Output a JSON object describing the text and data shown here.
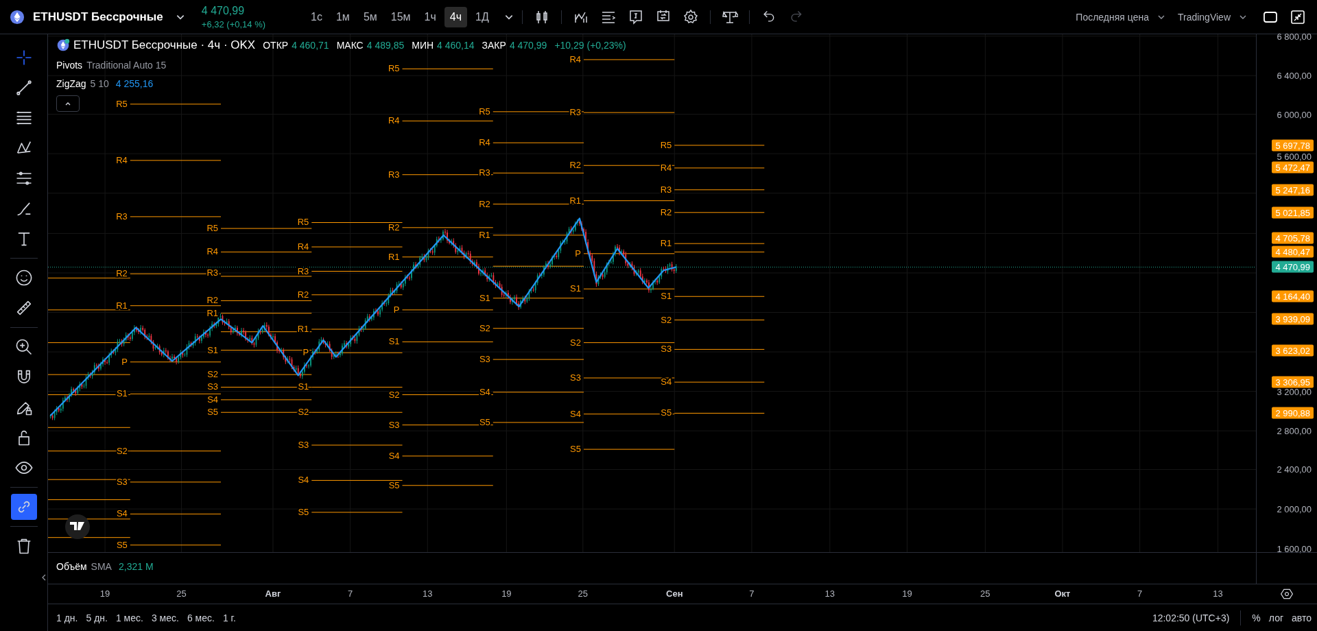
{
  "header": {
    "symbol": "ETHUSDT Бессрочные",
    "price": "4 470,99",
    "change": "+6,32 (+0,14 %)",
    "intervals": [
      {
        "label": "1с",
        "selected": false
      },
      {
        "label": "1м",
        "selected": false
      },
      {
        "label": "5м",
        "selected": false
      },
      {
        "label": "15м",
        "selected": false
      },
      {
        "label": "1ч",
        "selected": false
      },
      {
        "label": "4ч",
        "selected": true
      },
      {
        "label": "1Д",
        "selected": false
      }
    ],
    "history": [
      {
        "kind": "undo",
        "disabled": false
      },
      {
        "kind": "redo",
        "disabled": true
      }
    ],
    "price_source": "Последняя цена",
    "chart_brand": "TradingView"
  },
  "toolbar": [
    {
      "kind": "crosshair",
      "selected": true
    },
    {
      "kind": "trend-line",
      "selected": false
    },
    {
      "kind": "fib",
      "selected": false
    },
    {
      "kind": "pattern",
      "selected": false
    },
    {
      "kind": "parallel",
      "selected": false
    },
    {
      "kind": "brush",
      "selected": false
    },
    {
      "kind": "text",
      "selected": false
    },
    {
      "kind": "emoji",
      "selected": false
    },
    {
      "kind": "ruler",
      "selected": false
    },
    {
      "kind": "zoom",
      "selected": false
    },
    {
      "kind": "magnet",
      "selected": false,
      "on": false
    },
    {
      "kind": "pencil-lock",
      "selected": false,
      "on": false
    },
    {
      "kind": "lock",
      "selected": false,
      "on": false
    },
    {
      "kind": "eye",
      "selected": false,
      "on": false
    },
    {
      "kind": "link",
      "selected": false,
      "on": true
    },
    {
      "kind": "trash",
      "selected": false
    }
  ],
  "legend": {
    "title": "ETHUSDT Бессрочные · 4ч · OKX",
    "ohlc": [
      {
        "label": "ОТКР",
        "value": "4 460,71"
      },
      {
        "label": "МАКС",
        "value": "4 489,85"
      },
      {
        "label": "МИН",
        "value": "4 460,14"
      },
      {
        "label": "ЗАКР",
        "value": "4 470,99"
      }
    ],
    "change": "+10,29 (+0,23%)",
    "indicators": [
      {
        "name": "Pivots",
        "params": "Traditional Auto 15"
      },
      {
        "name": "ZigZag",
        "params": "5 10",
        "value": "4 255,16"
      }
    ]
  },
  "pivots": [
    {
      "levels": [
        "R5",
        "R4",
        "R3",
        "R2",
        "R1",
        "P",
        "S1",
        "S2",
        "S3",
        "S4",
        "S5"
      ]
    },
    {
      "levels": [
        "R5",
        "R4",
        "R3",
        "R2",
        "R1",
        "S1",
        "S2",
        "S3",
        "S4",
        "S5"
      ]
    },
    {
      "levels": [
        "R5",
        "R4",
        "R3",
        "R2",
        "R1",
        "P",
        "S1",
        "S2",
        "S3",
        "S4",
        "S5"
      ]
    },
    {
      "levels": [
        "R5",
        "R4",
        "R3",
        "R2",
        "R1",
        "P",
        "S1",
        "S2",
        "S3",
        "S4",
        "S5"
      ]
    },
    {
      "levels": [
        "R5",
        "R4",
        "R3",
        "R2",
        "R1",
        "S1",
        "S2",
        "S3",
        "S4",
        "S5"
      ]
    },
    {
      "levels": [
        "R4",
        "R3",
        "R2",
        "R1",
        "P",
        "S1",
        "S2",
        "S3",
        "S4",
        "S5"
      ]
    },
    {
      "levels": [
        "R5",
        "R4",
        "R3",
        "R2",
        "R1",
        "S1",
        "S2",
        "S3",
        "S4",
        "S5"
      ]
    }
  ],
  "volume": {
    "name": "Объём",
    "ma": "SMA",
    "value": "2,321 M"
  },
  "price_axis": {
    "ticks": [
      "6 800,00",
      "6 400,00",
      "6 000,00",
      "5 600,00",
      "3 200,00",
      "2 800,00",
      "2 400,00",
      "2 000,00",
      "1 600,00"
    ],
    "tags": [
      {
        "value": "5 697,78",
        "kind": "pivot"
      },
      {
        "value": "5 472,47",
        "kind": "pivot"
      },
      {
        "value": "5 247,16",
        "kind": "pivot"
      },
      {
        "value": "5 021,85",
        "kind": "pivot"
      },
      {
        "value": "4 705,78",
        "kind": "pivot"
      },
      {
        "value": "4 480,47",
        "kind": "pivot"
      },
      {
        "value": "4 470,99",
        "kind": "last"
      },
      {
        "value": "4 164,40",
        "kind": "pivot"
      },
      {
        "value": "3 939,09",
        "kind": "pivot"
      },
      {
        "value": "3 623,02",
        "kind": "pivot"
      },
      {
        "value": "3 306,95",
        "kind": "pivot"
      },
      {
        "value": "2 990,88",
        "kind": "pivot"
      }
    ]
  },
  "time_axis": [
    {
      "text": "19",
      "kind": "day"
    },
    {
      "text": "25",
      "kind": "day"
    },
    {
      "text": "Авг",
      "kind": "month"
    },
    {
      "text": "7",
      "kind": "day"
    },
    {
      "text": "13",
      "kind": "day"
    },
    {
      "text": "19",
      "kind": "day"
    },
    {
      "text": "25",
      "kind": "day"
    },
    {
      "text": "Сен",
      "kind": "month"
    },
    {
      "text": "7",
      "kind": "day"
    },
    {
      "text": "13",
      "kind": "day"
    },
    {
      "text": "19",
      "kind": "day"
    },
    {
      "text": "25",
      "kind": "day"
    },
    {
      "text": "Окт",
      "kind": "month"
    },
    {
      "text": "7",
      "kind": "day"
    },
    {
      "text": "13",
      "kind": "day"
    }
  ],
  "range_bar": {
    "ranges": [
      "1 дн.",
      "5 дн.",
      "1 мес.",
      "3 мес.",
      "6 мес.",
      "1 г."
    ],
    "time": "12:02:50 (UTC+3)",
    "percent": "%",
    "log": "лог",
    "auto": "авто"
  }
}
